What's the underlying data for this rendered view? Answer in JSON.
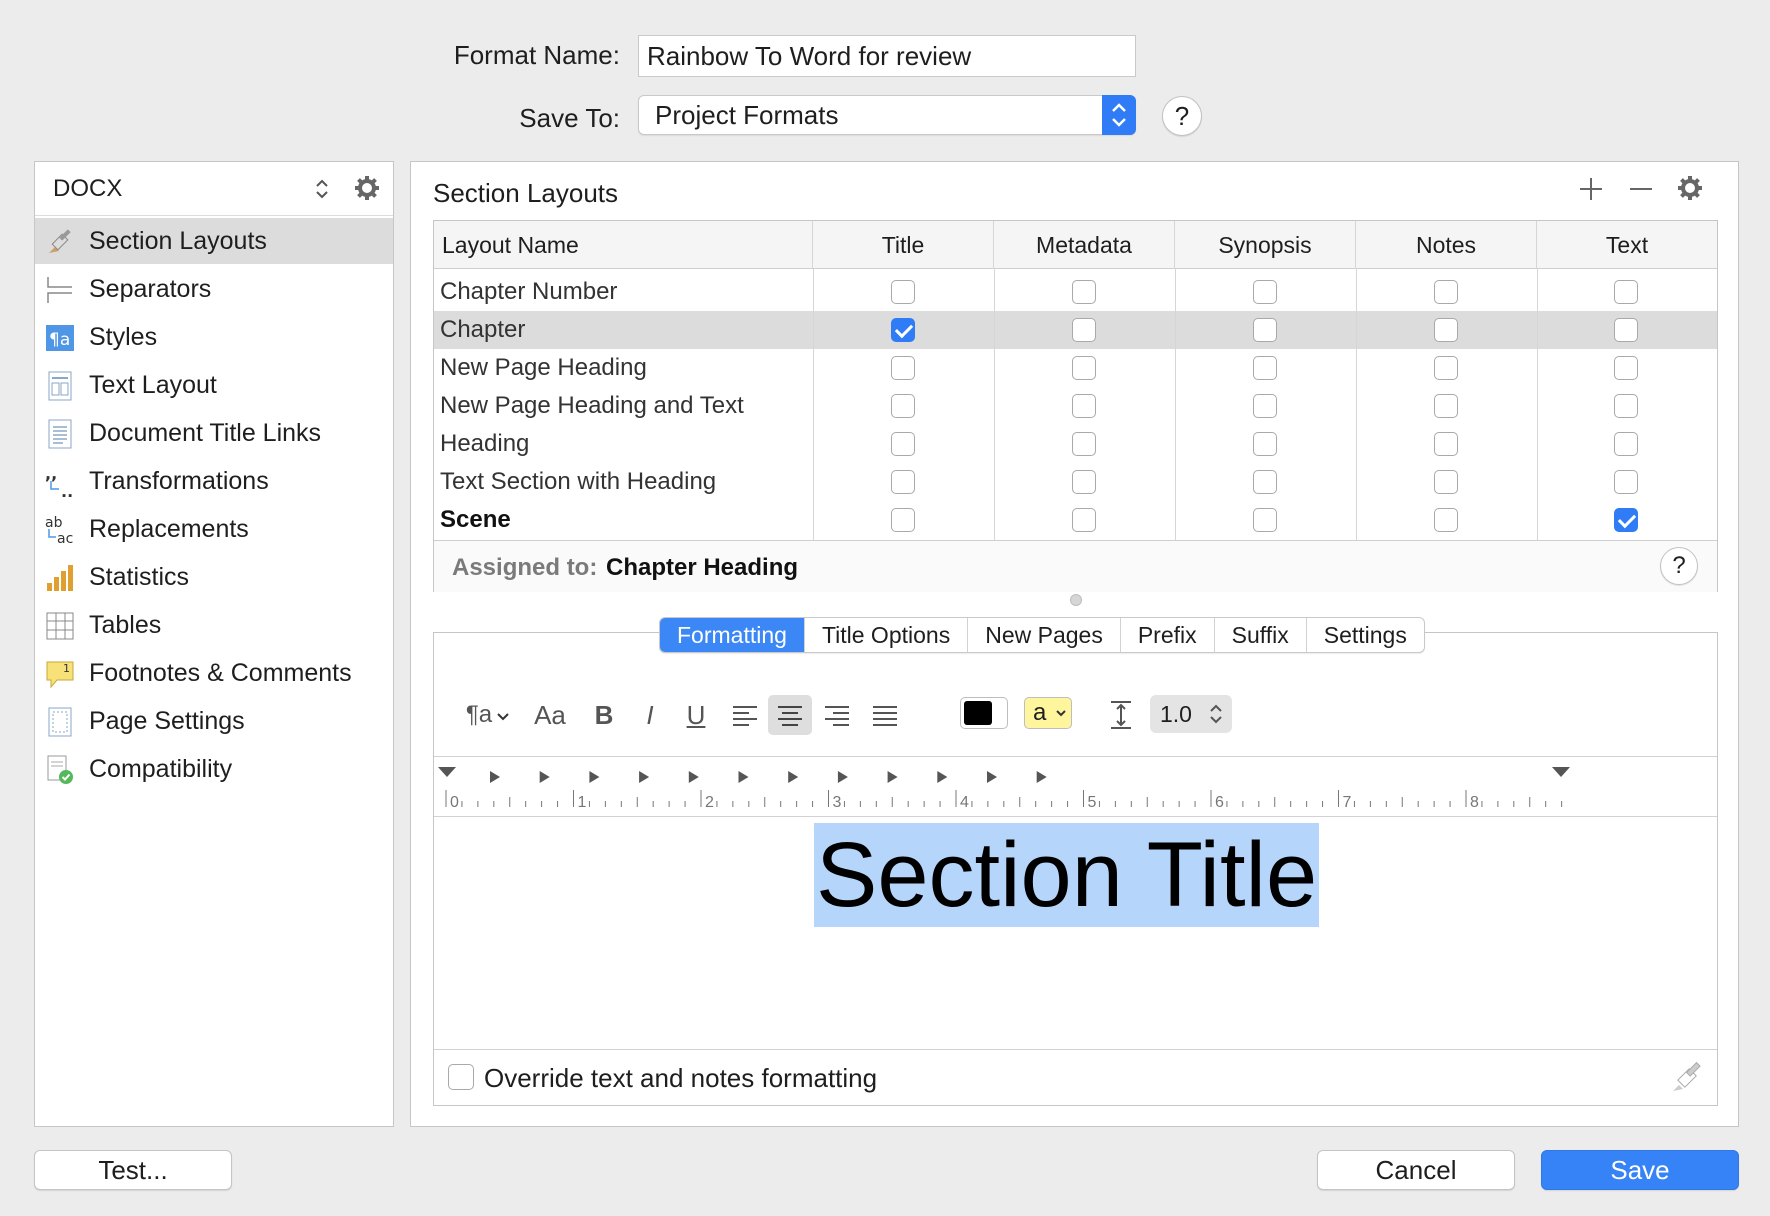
{
  "form": {
    "format_name_label": "Format Name:",
    "format_name_value": "Rainbow To Word for review",
    "save_to_label": "Save To:",
    "save_to_value": "Project Formats",
    "help_label": "?"
  },
  "sidebar": {
    "format": "DOCX",
    "items": [
      {
        "label": "Section Layouts",
        "icon": "brush-icon",
        "selected": true
      },
      {
        "label": "Separators",
        "icon": "separator-icon",
        "selected": false
      },
      {
        "label": "Styles",
        "icon": "paragraph-style-icon",
        "selected": false
      },
      {
        "label": "Text Layout",
        "icon": "text-layout-icon",
        "selected": false
      },
      {
        "label": "Document Title Links",
        "icon": "document-icon",
        "selected": false
      },
      {
        "label": "Transformations",
        "icon": "quote-transform-icon",
        "selected": false
      },
      {
        "label": "Replacements",
        "icon": "replace-icon",
        "selected": false
      },
      {
        "label": "Statistics",
        "icon": "bar-chart-icon",
        "selected": false
      },
      {
        "label": "Tables",
        "icon": "table-icon",
        "selected": false
      },
      {
        "label": "Footnotes & Comments",
        "icon": "footnote-icon",
        "selected": false
      },
      {
        "label": "Page Settings",
        "icon": "page-icon",
        "selected": false
      },
      {
        "label": "Compatibility",
        "icon": "compatibility-icon",
        "selected": false
      }
    ]
  },
  "main": {
    "title": "Section Layouts",
    "columns": [
      "Layout Name",
      "Title",
      "Metadata",
      "Synopsis",
      "Notes",
      "Text"
    ],
    "rows": [
      {
        "name": "Chapter Number",
        "checks": [
          false,
          false,
          false,
          false,
          false
        ],
        "selected": false,
        "bold": false
      },
      {
        "name": "Chapter",
        "checks": [
          true,
          false,
          false,
          false,
          false
        ],
        "selected": true,
        "bold": false
      },
      {
        "name": "New Page Heading",
        "checks": [
          false,
          false,
          false,
          false,
          false
        ],
        "selected": false,
        "bold": false
      },
      {
        "name": "New Page Heading and Text",
        "checks": [
          false,
          false,
          false,
          false,
          false
        ],
        "selected": false,
        "bold": false
      },
      {
        "name": "Heading",
        "checks": [
          false,
          false,
          false,
          false,
          false
        ],
        "selected": false,
        "bold": false
      },
      {
        "name": "Text Section with Heading",
        "checks": [
          false,
          false,
          false,
          false,
          false
        ],
        "selected": false,
        "bold": false
      },
      {
        "name": "Scene",
        "checks": [
          false,
          false,
          false,
          false,
          true
        ],
        "selected": false,
        "bold": true
      }
    ],
    "assigned_label": "Assigned to:",
    "assigned_value": "Chapter Heading",
    "tabs": [
      {
        "label": "Formatting",
        "active": true
      },
      {
        "label": "Title Options",
        "active": false
      },
      {
        "label": "New Pages",
        "active": false
      },
      {
        "label": "Prefix",
        "active": false
      },
      {
        "label": "Suffix",
        "active": false
      },
      {
        "label": "Settings",
        "active": false
      }
    ],
    "format_bar": {
      "font_size_label": "Aa",
      "bold": "B",
      "italic": "I",
      "underline": "U",
      "highlight_letter": "a",
      "line_spacing": "1.0",
      "text_color": "#000000",
      "highlight_color": "#fff59d"
    },
    "ruler_numbers": [
      "0",
      "1",
      "2",
      "3",
      "4",
      "5",
      "6",
      "7",
      "8"
    ],
    "preview_text": "Section Title",
    "override_label": "Override text and notes formatting"
  },
  "footer": {
    "test_label": "Test...",
    "cancel_label": "Cancel",
    "save_label": "Save"
  },
  "colors": {
    "accent": "#3583f6",
    "selection": "#b6d5fb"
  }
}
